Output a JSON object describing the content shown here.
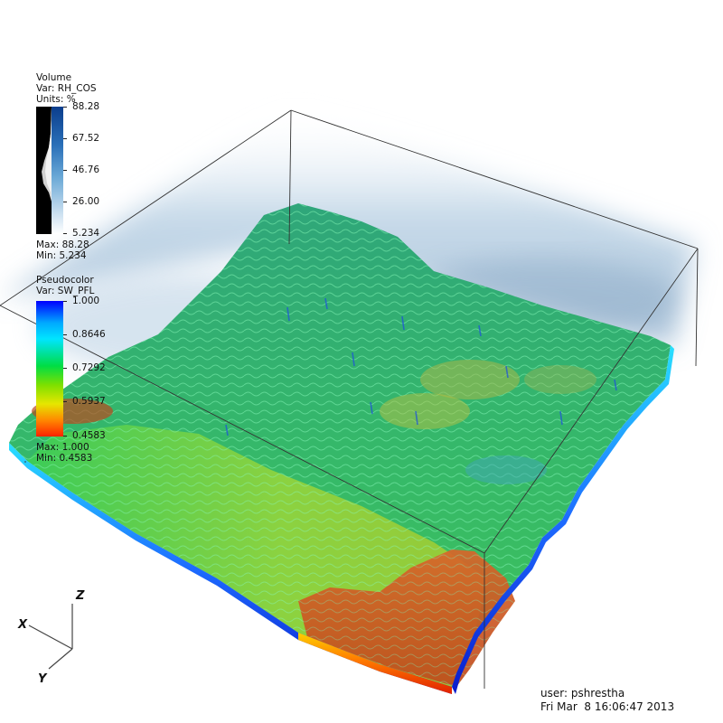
{
  "volume_legend": {
    "plot_type": "Volume",
    "var": "Var: RH_COS",
    "units": "Units: %",
    "ticks": [
      "88.28",
      "67.52",
      "46.76",
      "26.00",
      "5.234"
    ],
    "max": "Max:  88.28",
    "min": "Min:  5.234",
    "colors": {
      "top": "#0b3d8c",
      "mid": "#6aa8d6",
      "bottom": "#ffffff"
    }
  },
  "pseudocolor_legend": {
    "plot_type": "Pseudocolor",
    "var": "Var: SW_PFL",
    "ticks": [
      "1.000",
      "0.8646",
      "0.7292",
      "0.5937",
      "0.4583"
    ],
    "max": "Max:  1.000",
    "min": "Min:  0.4583",
    "colors": [
      "#0000ff",
      "#00e5ff",
      "#00dd44",
      "#e6e600",
      "#ff2200"
    ]
  },
  "axes": {
    "x": "X",
    "y": "Y",
    "z": "Z"
  },
  "footer": {
    "user": "user: pshrestha",
    "timestamp": "Fri Mar  8 16:06:47 2013"
  }
}
